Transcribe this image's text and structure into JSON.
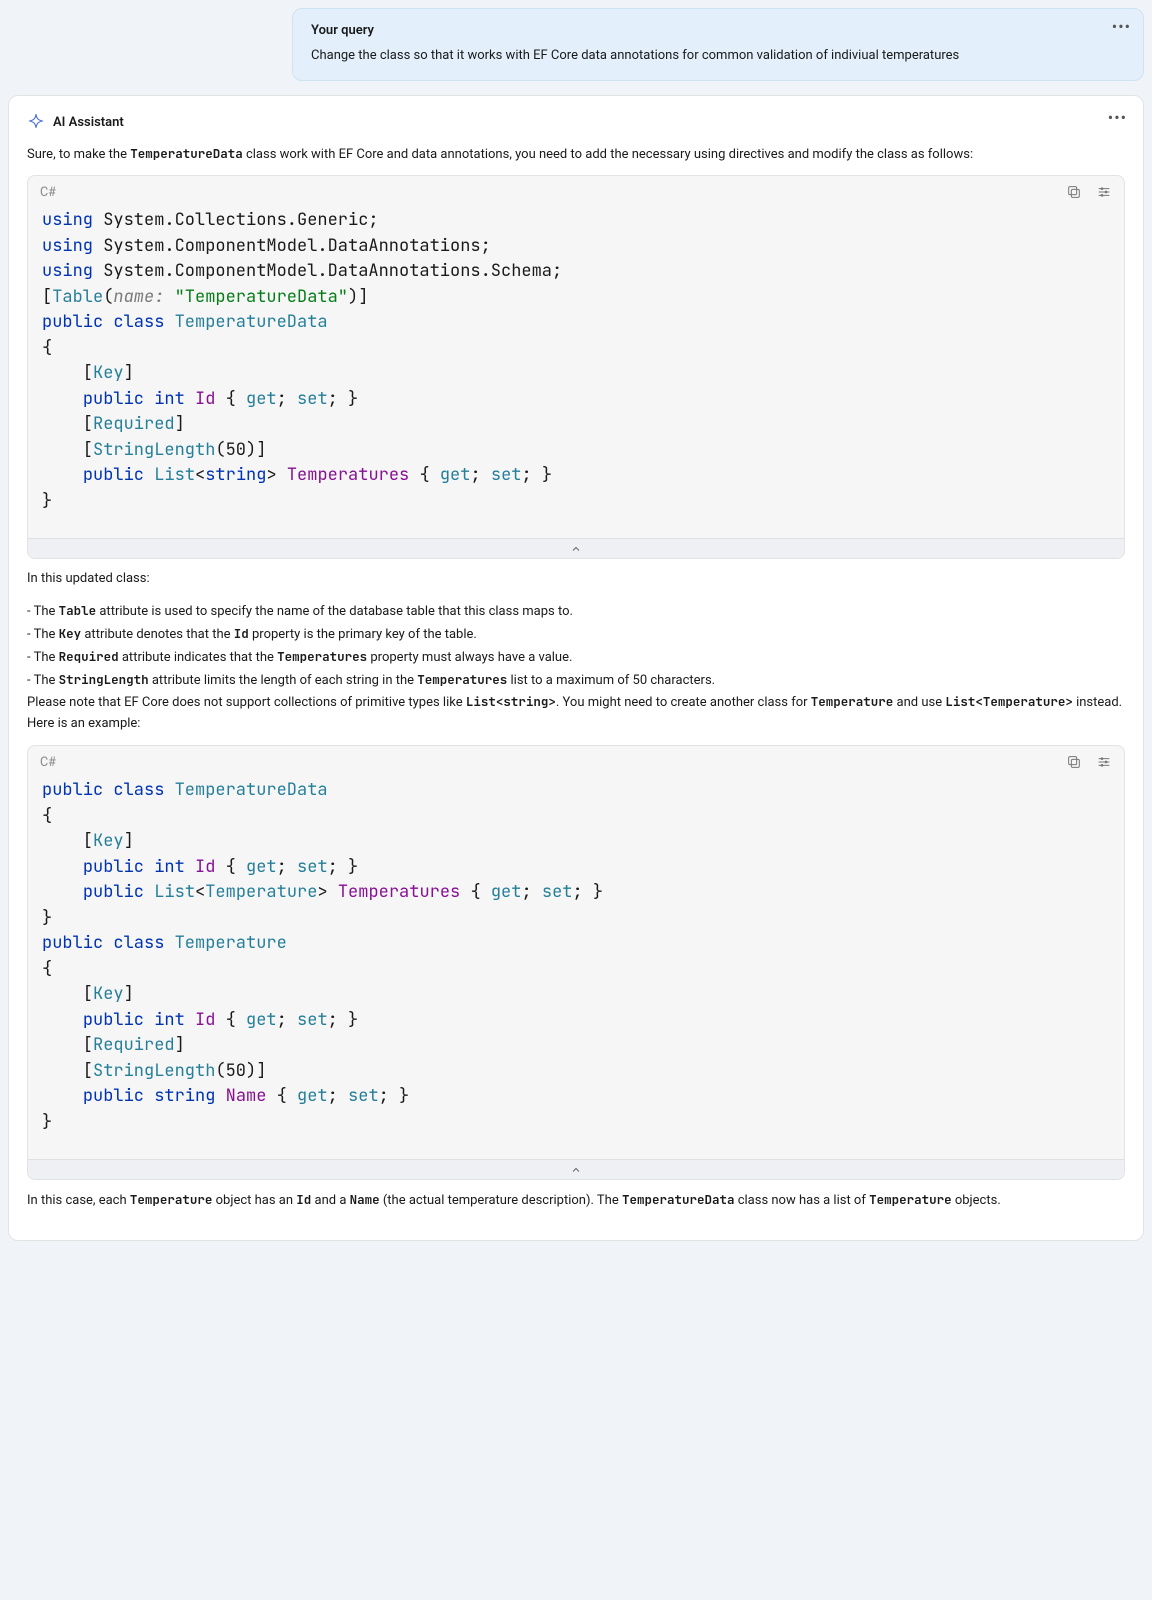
{
  "query": {
    "title": "Your query",
    "text": "Change the class so that it works with EF Core data annotations for common validation of indiviual temperatures"
  },
  "assistant": {
    "name": "AI Assistant",
    "intro_1": "Sure, to make the ",
    "intro_code_1": "TemperatureData",
    "intro_2": " class work with EF Core and data annotations, you need to add the necessary using directives and modify the class as follows:"
  },
  "code_block_1": {
    "lang": "C#",
    "l1": {
      "a": "using",
      "b": " System.Collections.Generic;"
    },
    "l2": {
      "a": "using",
      "b": " System.ComponentModel.DataAnnotations;"
    },
    "l3": {
      "a": "using",
      "b": " System.ComponentModel.DataAnnotations.Schema;"
    },
    "l4": {
      "a": "[",
      "b": "Table",
      "c": "(",
      "d": "name:",
      "e": " ",
      "f": "\"TemperatureData\"",
      "g": ")]"
    },
    "l5": {
      "a": "public class ",
      "b": "TemperatureData"
    },
    "l6": {
      "a": "{"
    },
    "l7": {
      "a": "    [",
      "b": "Key",
      "c": "]"
    },
    "l8": {
      "a": "    ",
      "b": "public int ",
      "c": "Id ",
      "d": "{ ",
      "e": "get",
      "f": "; ",
      "g": "set",
      "h": "; }"
    },
    "l9": {
      "a": "    [",
      "b": "Required",
      "c": "]"
    },
    "l10": {
      "a": "    [",
      "b": "StringLength",
      "c": "(50)]"
    },
    "l11": {
      "a": "    ",
      "b": "public ",
      "c": "List",
      "d": "<",
      "e": "string",
      "f": "> ",
      "g": "Temperatures ",
      "h": "{ ",
      "i": "get",
      "j": "; ",
      "k": "set",
      "l": "; }"
    },
    "l12": {
      "a": "}"
    }
  },
  "explain": {
    "lead": "In this updated class:",
    "b1_a": "The ",
    "b1_code1": "Table",
    "b1_b": " attribute is used to specify the name of the database table that this class maps to.",
    "b2_a": "The ",
    "b2_code1": "Key",
    "b2_b": " attribute denotes that the ",
    "b2_code2": "Id",
    "b2_c": " property is the primary key of the table.",
    "b3_a": "The ",
    "b3_code1": "Required",
    "b3_b": " attribute indicates that the ",
    "b3_code2": "Temperatures",
    "b3_c": " property must always have a value.",
    "b4_a": "The ",
    "b4_code1": "StringLength",
    "b4_b": " attribute limits the length of each string in the ",
    "b4_code2": "Temperatures",
    "b4_c": " list to a maximum of 50 characters.",
    "note_a": "Please note that EF Core does not support collections of primitive types like ",
    "note_code1": "List<string>",
    "note_b": ". You might need to create another class for ",
    "note_code2": "Temperature",
    "note_c": " and use ",
    "note_code3": "List<Temperature>",
    "note_d": " instead. Here is an example:"
  },
  "code_block_2": {
    "lang": "C#",
    "l1": {
      "a": "public class ",
      "b": "TemperatureData"
    },
    "l2": {
      "a": "{"
    },
    "l3": {
      "a": "    [",
      "b": "Key",
      "c": "]"
    },
    "l4": {
      "a": "    ",
      "b": "public int ",
      "c": "Id ",
      "d": "{ ",
      "e": "get",
      "f": "; ",
      "g": "set",
      "h": "; }"
    },
    "l5": {
      "a": "    ",
      "b": "public ",
      "c": "List",
      "d": "<",
      "e": "Temperature",
      "f": "> ",
      "g": "Temperatures ",
      "h": "{ ",
      "i": "get",
      "j": "; ",
      "k": "set",
      "l": "; }"
    },
    "l6": {
      "a": "}"
    },
    "l7": {
      "a": "public class ",
      "b": "Temperature"
    },
    "l8": {
      "a": "{"
    },
    "l9": {
      "a": "    [",
      "b": "Key",
      "c": "]"
    },
    "l10": {
      "a": "    ",
      "b": "public int ",
      "c": "Id ",
      "d": "{ ",
      "e": "get",
      "f": "; ",
      "g": "set",
      "h": "; }"
    },
    "l11": {
      "a": "    [",
      "b": "Required",
      "c": "]"
    },
    "l12": {
      "a": "    [",
      "b": "StringLength",
      "c": "(50)]"
    },
    "l13": {
      "a": "    ",
      "b": "public string ",
      "c": "Name ",
      "d": "{ ",
      "e": "get",
      "f": "; ",
      "g": "set",
      "h": "; }"
    },
    "l14": {
      "a": "}"
    }
  },
  "closing": {
    "a": "In this case, each ",
    "c1": "Temperature",
    "b": " object has an ",
    "c2": "Id",
    "c": " and a ",
    "c3": "Name",
    "d": " (the actual temperature description). The ",
    "c4": "TemperatureData",
    "e": " class now has a list of ",
    "c5": "Temperature",
    "f": " objects."
  }
}
